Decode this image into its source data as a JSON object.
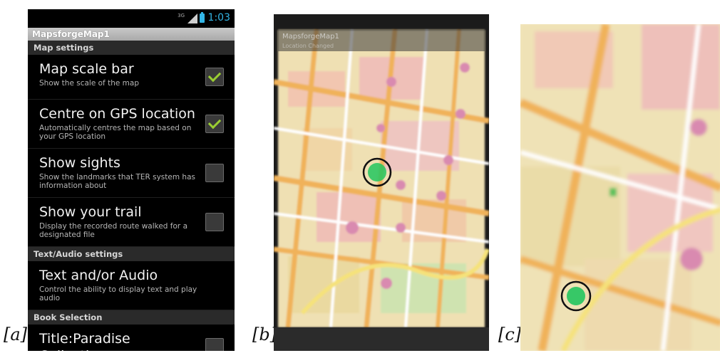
{
  "labels": {
    "a": "[a]",
    "b": "[b]",
    "c": "[c]"
  },
  "status_bar": {
    "network": "3G",
    "time": "1:03"
  },
  "app_title": "MapsforgeMap1",
  "sections": {
    "map_settings": "Map settings",
    "text_audio_settings": "Text/Audio settings",
    "book_selection": "Book Selection"
  },
  "prefs": {
    "scale_bar": {
      "title": "Map scale bar",
      "summary": "Show the scale of the map",
      "checked": true
    },
    "centre_gps": {
      "title": "Centre on GPS location",
      "summary": "Automatically centres the map based on your GPS location",
      "checked": true
    },
    "show_sights": {
      "title": "Show sights",
      "summary": "Show the landmarks that TER system has information about",
      "checked": false
    },
    "show_trail": {
      "title": "Show your trail",
      "summary": "Display the recorded route walked for a designated file",
      "checked": false
    },
    "text_audio": {
      "title": "Text and/or Audio",
      "summary": "Control the ability to display text and play audio"
    },
    "book_title": {
      "title": "Title:Paradise Collection",
      "checked": false
    }
  },
  "photo_b": {
    "title": "MapsforgeMap1",
    "subtitle": "Location Changed"
  },
  "colors": {
    "accent": "#33b5e5",
    "check": "#9acd32",
    "location_marker": "#22c55e"
  }
}
